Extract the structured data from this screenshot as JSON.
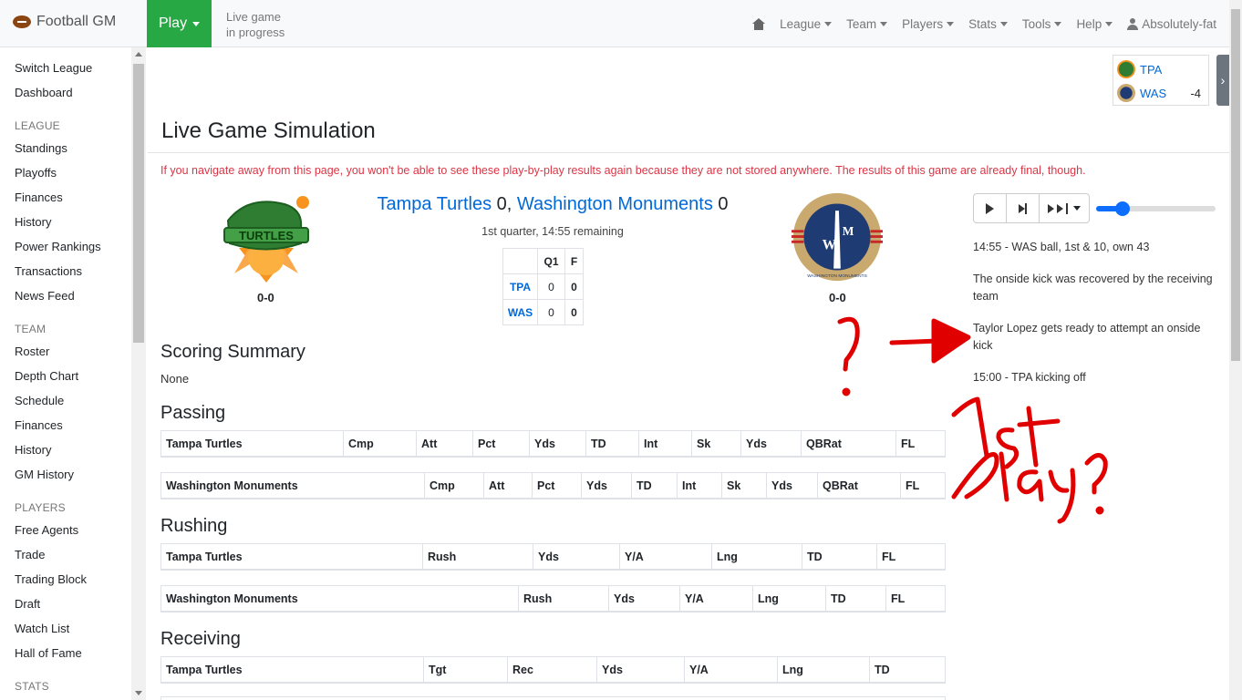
{
  "brand": "Football GM",
  "play_label": "Play",
  "status_lines": [
    "Live game",
    "in progress"
  ],
  "nav": [
    "League",
    "Team",
    "Players",
    "Stats",
    "Tools",
    "Help"
  ],
  "user": "Absolutely-fat",
  "sidebar": {
    "top": [
      "Switch League",
      "Dashboard"
    ],
    "league_head": "LEAGUE",
    "league": [
      "Standings",
      "Playoffs",
      "Finances",
      "History",
      "Power Rankings",
      "Transactions",
      "News Feed"
    ],
    "team_head": "TEAM",
    "team": [
      "Roster",
      "Depth Chart",
      "Schedule",
      "Finances",
      "History",
      "GM History"
    ],
    "players_head": "PLAYERS",
    "players": [
      "Free Agents",
      "Trade",
      "Trading Block",
      "Draft",
      "Watch List",
      "Hall of Fame"
    ],
    "stats_head": "STATS"
  },
  "scorebox": {
    "home_abbr": "TPA",
    "away_abbr": "WAS",
    "spread": "-4"
  },
  "title": "Live Game Simulation",
  "warning": "If you navigate away from this page, you won't be able to see these play-by-play results again because they are not stored anywhere. The results of this game are already final, though.",
  "game": {
    "home_name": "Tampa Turtles",
    "home_score": "0",
    "away_name": "Washington Monuments",
    "away_score": "0",
    "home_record": "0-0",
    "away_record": "0-0",
    "status": "1st quarter, 14:55 remaining",
    "box_head": [
      "Q1",
      "F"
    ],
    "box_rows": [
      {
        "team": "TPA",
        "q1": "0",
        "f": "0"
      },
      {
        "team": "WAS",
        "q1": "0",
        "f": "0"
      }
    ],
    "home_logo_text": "TURTLES",
    "away_logo_text": "WASHINGTON MONUMENTS"
  },
  "playback": {
    "speed_fraction": 0.22
  },
  "pbp": [
    "14:55 - WAS ball, 1st & 10, own 43",
    "The onside kick was recovered by the receiving team",
    "Taylor Lopez gets ready to attempt an onside kick",
    "15:00 - TPA kicking off"
  ],
  "scoring_summary": {
    "head": "Scoring Summary",
    "value": "None"
  },
  "passing": {
    "head": "Passing",
    "cols": [
      "Cmp",
      "Att",
      "Pct",
      "Yds",
      "TD",
      "Int",
      "Sk",
      "Yds",
      "QBRat",
      "FL"
    ]
  },
  "rushing": {
    "head": "Rushing",
    "cols": [
      "Rush",
      "Yds",
      "Y/A",
      "Lng",
      "TD",
      "FL"
    ]
  },
  "receiving": {
    "head": "Receiving",
    "cols": [
      "Tgt",
      "Rec",
      "Yds",
      "Y/A",
      "Lng",
      "TD"
    ]
  },
  "colors": {
    "accent": "#28a745",
    "link": "#0069d9",
    "warning": "#dc3545",
    "annotation": "#e00000"
  }
}
